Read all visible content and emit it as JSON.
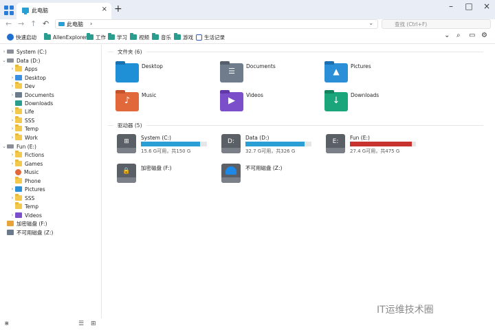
{
  "tab": {
    "title": "此电脑"
  },
  "address": {
    "path": "此电脑"
  },
  "search": {
    "placeholder": "查找 (Ctrl+F)"
  },
  "quick_bar": [
    {
      "label": "快速启动",
      "icon": "star-icon"
    },
    {
      "label": "AllenExplorer",
      "icon": "folder-icon"
    },
    {
      "label": "工作",
      "icon": "folder-icon"
    },
    {
      "label": "学习",
      "icon": "folder-icon"
    },
    {
      "label": "视频",
      "icon": "folder-icon"
    },
    {
      "label": "音乐",
      "icon": "folder-icon"
    },
    {
      "label": "游戏",
      "icon": "folder-icon"
    },
    {
      "label": "生活记录",
      "icon": "record-icon"
    }
  ],
  "sidebar": {
    "system": "System (C:)",
    "data": "Data (D:)",
    "data_items": [
      "Apps",
      "Desktop",
      "Dev",
      "Documents",
      "Downloads",
      "Life",
      "SSS",
      "Temp",
      "Work"
    ],
    "fun": "Fun (E:)",
    "fun_items": [
      "Fictions",
      "Games",
      "Music",
      "Phone",
      "Pictures",
      "SSS",
      "Temp",
      "Videos"
    ],
    "encrypted": "加密磁盘 (F:)",
    "unavailable": "不可用磁盘 (Z:)"
  },
  "folders_section": "文件夹 (6)",
  "folders": [
    {
      "name": "Desktop",
      "color": "#1f8fd6"
    },
    {
      "name": "Documents",
      "color": "#6e7c8c"
    },
    {
      "name": "Pictures",
      "color": "#2a8fd6"
    },
    {
      "name": "Music",
      "color": "#e0683a"
    },
    {
      "name": "Videos",
      "color": "#7b4fc9"
    },
    {
      "name": "Downloads",
      "color": "#1aa67a"
    }
  ],
  "drives_section": "驱动器 (5)",
  "drives": [
    {
      "name": "System (C:)",
      "letter": "⊞",
      "used_fraction": 0.9,
      "bar_color": "#2a9fd6",
      "stat": "15.6 G可用，共150 G"
    },
    {
      "name": "Data (D:)",
      "letter": "D:",
      "used_fraction": 0.9,
      "bar_color": "#2a9fd6",
      "stat": "32.7 G可用，共326 G"
    },
    {
      "name": "Fun (E:)",
      "letter": "E:",
      "used_fraction": 0.94,
      "bar_color": "#c8332f",
      "stat": "27.4 G可用，共475 G"
    },
    {
      "name": "加密磁盘 (F:)",
      "letter": "🔒"
    },
    {
      "name": "不可用磁盘 (Z:)",
      "letter": ""
    }
  ],
  "watermark": "IT运维技术圈"
}
